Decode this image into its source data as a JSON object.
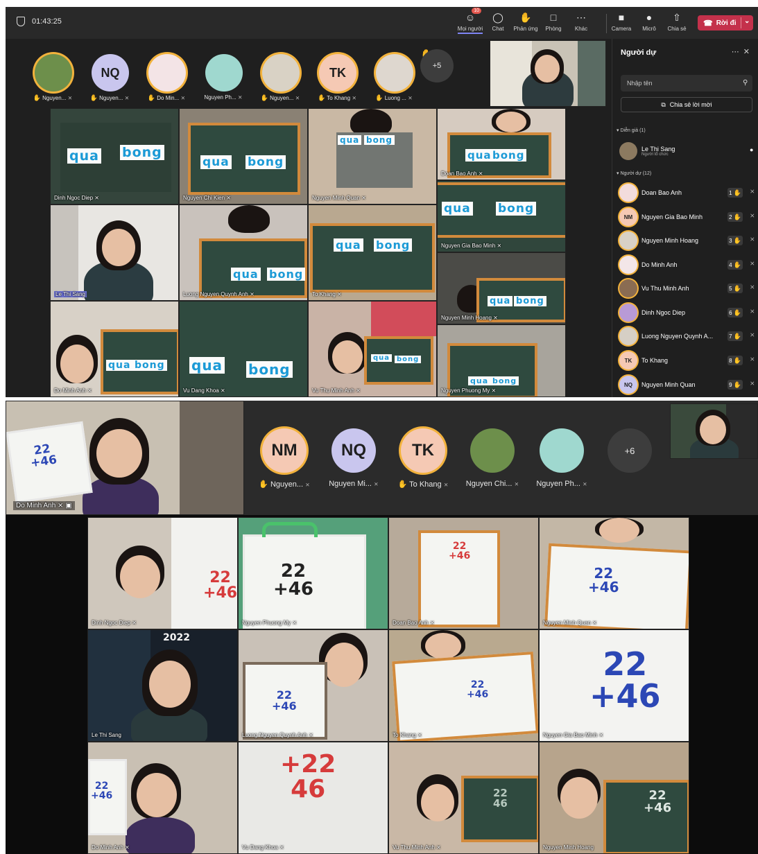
{
  "meeting1": {
    "timer": "01:43:25",
    "toolbar": [
      {
        "label": "Mọi người",
        "icon": "people-icon",
        "badge": "10",
        "active": true
      },
      {
        "label": "Chat",
        "icon": "chat-icon"
      },
      {
        "label": "Phản ứng",
        "icon": "reactions-icon"
      },
      {
        "label": "Phòng",
        "icon": "rooms-icon"
      },
      {
        "label": "Khác",
        "icon": "more-icon"
      },
      {
        "label": "Camera",
        "icon": "camera-icon"
      },
      {
        "label": "Micrô",
        "icon": "mic-icon"
      },
      {
        "label": "Chia sẻ",
        "icon": "share-icon"
      }
    ],
    "leave_label": "Rời đi",
    "avatars": [
      {
        "name": "Nguyen...",
        "initials": "",
        "color": "#6d8f4b"
      },
      {
        "name": "Nguyen...",
        "initials": "NQ",
        "color": "#c9c6ee"
      },
      {
        "name": "Do Min...",
        "initials": "",
        "color": "#f3e4e6"
      },
      {
        "name": "Nguyen Ph...",
        "initials": "",
        "color": "#9fd8cf"
      },
      {
        "name": "Nguyen...",
        "initials": "",
        "color": "#d9d2c5"
      },
      {
        "name": "To Khang",
        "initials": "TK",
        "color": "#f5c9b4"
      },
      {
        "name": "Luong ...",
        "initials": "",
        "color": "#ded7cf"
      }
    ],
    "more_count": "+5",
    "tiles": [
      {
        "caption": "Dinh Ngoc Diep",
        "cards": [
          "qua",
          "bong"
        ]
      },
      {
        "caption": "Nguyen Chi Kien",
        "cards": [
          "qua",
          "bong"
        ]
      },
      {
        "caption": "Nguyen Minh Quan",
        "cards": [
          "qua",
          "bong"
        ]
      },
      {
        "caption": "Doan Bao Anh",
        "cards": [
          "qua",
          "bong"
        ]
      },
      {
        "caption": "Le Thi Sang",
        "cards": []
      },
      {
        "caption": "Luong Nguyen Quynh Anh",
        "cards": [
          "qua",
          "bong"
        ]
      },
      {
        "caption": "To Khang",
        "cards": [
          "qua",
          "bong"
        ]
      },
      {
        "caption": "Nguyen Gia Bao Minh",
        "cards": [
          "qua",
          "bong"
        ]
      },
      {
        "caption": "Nguyen Minh Hoang",
        "cards": [
          "qua",
          "bong"
        ]
      },
      {
        "caption": "Do Minh Anh",
        "cards": [
          "qua",
          "bong"
        ]
      },
      {
        "caption": "Vu Dang Khoa",
        "cards": [
          "qua",
          "bong"
        ]
      },
      {
        "caption": "Vu Thu Minh Anh",
        "cards": [
          "qua",
          "bong"
        ]
      },
      {
        "caption": "Nguyen Phuong My",
        "cards": [
          "qua",
          "bong"
        ]
      }
    ],
    "panel": {
      "title": "Người dự",
      "search_placeholder": "Nhập tên",
      "share_label": "Chia sẻ lời mời",
      "presenters_label": "Diễn giả (1)",
      "presenter": {
        "name": "Le Thi Sang",
        "role": "Người tổ chức"
      },
      "attendees_label": "Người dự (12)",
      "attendees": [
        {
          "name": "Doan Bao Anh",
          "num": "1",
          "initials": "",
          "color": "#f2dcdc"
        },
        {
          "name": "Nguyen Gia Bao Minh",
          "num": "2",
          "initials": "NM",
          "color": "#f5c9b4"
        },
        {
          "name": "Nguyen Minh Hoang",
          "num": "3",
          "initials": "",
          "color": "#d8d1c6"
        },
        {
          "name": "Do Minh Anh",
          "num": "4",
          "initials": "",
          "color": "#f3e6e8"
        },
        {
          "name": "Vu Thu Minh Anh",
          "num": "5",
          "initials": "",
          "color": "#8a6c52"
        },
        {
          "name": "Dinh Ngoc Diep",
          "num": "6",
          "initials": "",
          "color": "#b89ad6"
        },
        {
          "name": "Luong Nguyen Quynh A...",
          "num": "7",
          "initials": "",
          "color": "#d6cfc5"
        },
        {
          "name": "To Khang",
          "num": "8",
          "initials": "TK",
          "color": "#f5c9b4"
        },
        {
          "name": "Nguyen Minh Quan",
          "num": "9",
          "initials": "NQ",
          "color": "#c9c6ee"
        }
      ]
    }
  },
  "meeting2": {
    "pinned_caption": "Do Minh Anh",
    "avatars": [
      {
        "name": "Nguyen...",
        "initials": "NM",
        "color": "#f5c9b4",
        "hand": true,
        "ring": true
      },
      {
        "name": "Nguyen Mi...",
        "initials": "NQ",
        "color": "#c9c6ee",
        "hand": false,
        "ring": false
      },
      {
        "name": "To Khang",
        "initials": "TK",
        "color": "#f5c9b4",
        "hand": true,
        "ring": true
      },
      {
        "name": "Nguyen Chi...",
        "initials": "",
        "color": "#6d8f4b",
        "hand": false,
        "ring": false
      },
      {
        "name": "Nguyen Ph...",
        "initials": "",
        "color": "#9fd8cf",
        "hand": false,
        "ring": false
      }
    ],
    "more_count": "+6",
    "banner_year": "2022",
    "tiles": [
      {
        "caption": "Dinh Ngoc Diep",
        "top": "22",
        "bottom": "46"
      },
      {
        "caption": "Nguyen Phuong My",
        "top": "22",
        "bottom": "46"
      },
      {
        "caption": "Doan Bao Anh",
        "top": "22",
        "bottom": "46"
      },
      {
        "caption": "Nguyen Minh Quan",
        "top": "22",
        "bottom": "46"
      },
      {
        "caption": "Le Thi Sang",
        "top": "2022",
        "bottom": ""
      },
      {
        "caption": "Luong Nguyen Quynh Anh",
        "top": "22",
        "bottom": "46"
      },
      {
        "caption": "To Khang",
        "top": "22",
        "bottom": "46"
      },
      {
        "caption": "Nguyen Gia Bao Minh",
        "top": "22",
        "bottom": "46"
      },
      {
        "caption": "Do Minh Anh",
        "top": "22",
        "bottom": "46"
      },
      {
        "caption": "Vu Dang Khoa",
        "top": "22",
        "bottom": "46"
      },
      {
        "caption": "Vu Thu Minh Anh",
        "top": "22",
        "bottom": "46"
      },
      {
        "caption": "Nguyen Minh Hoang",
        "top": "22",
        "bottom": "46"
      }
    ],
    "operator": "+"
  },
  "colors": {
    "accent": "#7f85f5",
    "leave": "#c4314b",
    "raised_hand": "#f2b23c",
    "board_frame": "#d28a3c"
  }
}
